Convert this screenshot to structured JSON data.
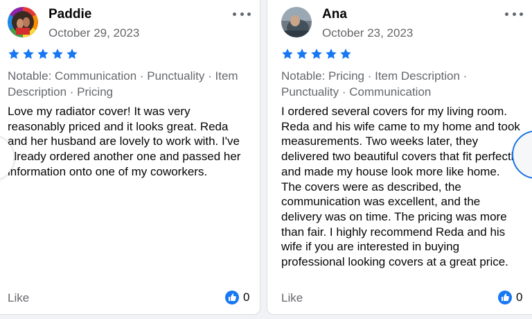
{
  "reviews": [
    {
      "name": "Paddie",
      "date": "October 29, 2023",
      "rating": 5,
      "notable": "Notable: Communication · Punctuality · Item Description · Pricing",
      "text": "Love my radiator cover! It was very reasonably priced and it looks great. Reda and her husband are lovely to work with. I've already ordered another one and passed her information onto one of my coworkers.",
      "like_label": "Like",
      "like_count": "0"
    },
    {
      "name": "Ana",
      "date": "October 23, 2023",
      "rating": 5,
      "notable": "Notable: Pricing · Item Description · Punctuality · Communication",
      "text": "I ordered several covers for my living room. Reda and his wife came to my home and took measurements. Two weeks later, they delivered two beautiful covers that fit perfectly and made my house look more like home. The covers were as described, the communication was excellent, and the delivery was on time. The pricing was more than fair. I highly recommend Reda and his wife if you are interested in buying professional looking covers at a great price.",
      "like_label": "Like",
      "like_count": "0"
    }
  ],
  "icons": {
    "star": "star-icon",
    "more": "more-options-icon",
    "reaction": "thumbs-up-icon",
    "prev": "previous-arrow",
    "next": "next-arrow"
  },
  "colors": {
    "star": "#1877f2",
    "reaction": "#1877f2",
    "muted_text": "#65676b",
    "card_border": "#dadde1",
    "nav_focus": "#1b74e4"
  }
}
